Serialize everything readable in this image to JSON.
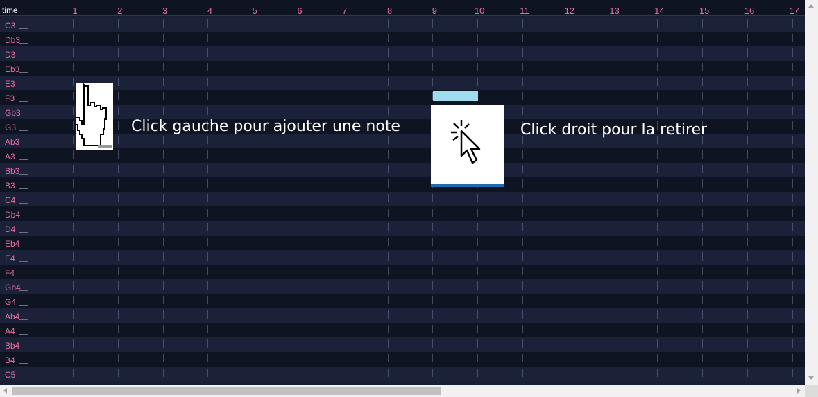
{
  "header": {
    "time_label": "time",
    "beats": [
      "1",
      "2",
      "3",
      "4",
      "5",
      "6",
      "7",
      "8",
      "9",
      "10",
      "11",
      "12",
      "13",
      "14",
      "15",
      "16",
      "17"
    ]
  },
  "notes": [
    "C3",
    "Db3",
    "D3",
    "Eb3",
    "E3",
    "F3",
    "Gb3",
    "G3",
    "Ab3",
    "A3",
    "Bb3",
    "B3",
    "C4",
    "Db4",
    "D4",
    "Eb4",
    "E4",
    "F4",
    "Gb4",
    "G4",
    "Ab4",
    "A4",
    "Bb4",
    "B4",
    "C5"
  ],
  "instructions": {
    "left": "Click gauche pour ajouter une note",
    "right": "Click droit pour la retirer"
  },
  "icons": {
    "left": "pointing-hand-icon",
    "right": "clicking-arrow-cursor-icon"
  },
  "colors": {
    "background": "#181f33",
    "label": "#e86fa0",
    "note_fill": "#a0dcef"
  }
}
